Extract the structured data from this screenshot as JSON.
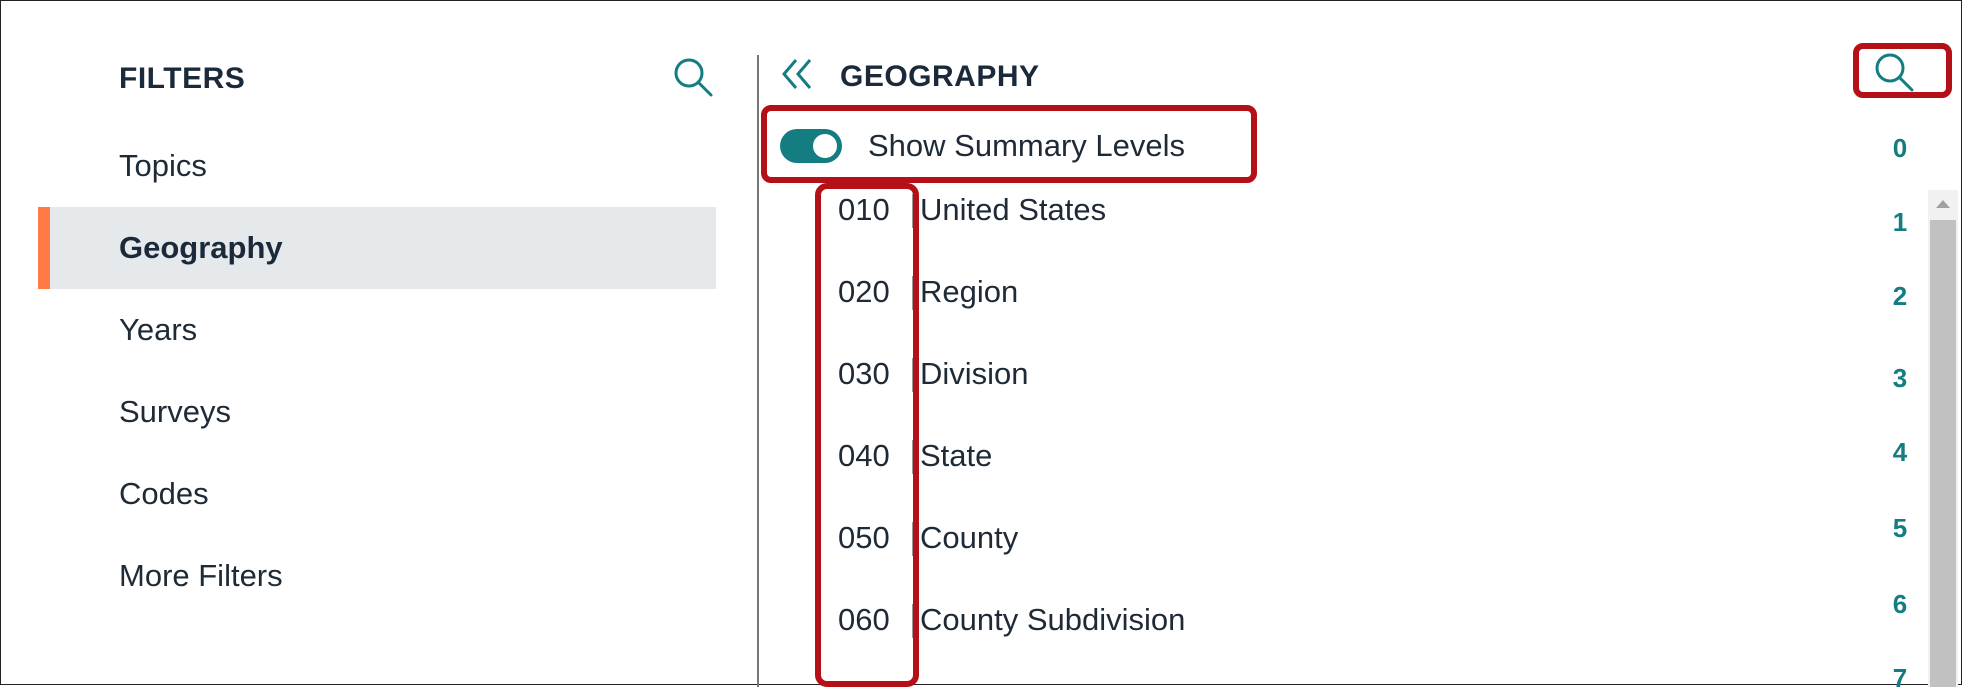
{
  "filters": {
    "title": "FILTERS",
    "items": [
      {
        "label": "Topics"
      },
      {
        "label": "Geography",
        "active": true
      },
      {
        "label": "Years"
      },
      {
        "label": "Surveys"
      },
      {
        "label": "Codes"
      },
      {
        "label": "More Filters"
      }
    ]
  },
  "geography": {
    "title": "GEOGRAPHY",
    "toggle_label": "Show Summary Levels",
    "toggle_on": true,
    "levels": [
      {
        "code": "010",
        "name": "United States"
      },
      {
        "code": "020",
        "name": "Region"
      },
      {
        "code": "030",
        "name": "Division"
      },
      {
        "code": "040",
        "name": "State"
      },
      {
        "code": "050",
        "name": "County"
      },
      {
        "code": "060",
        "name": "County Subdivision"
      }
    ]
  },
  "index": [
    "0",
    "1",
    "2",
    "3",
    "4",
    "5",
    "6",
    "7"
  ],
  "colors": {
    "accent_teal": "#147d82",
    "active_marker": "#ff7a45",
    "highlight_red": "#b50f17"
  },
  "icons": {
    "left_search": "search-icon",
    "right_search": "search-icon",
    "collapse": "double-chevron-left-icon"
  }
}
